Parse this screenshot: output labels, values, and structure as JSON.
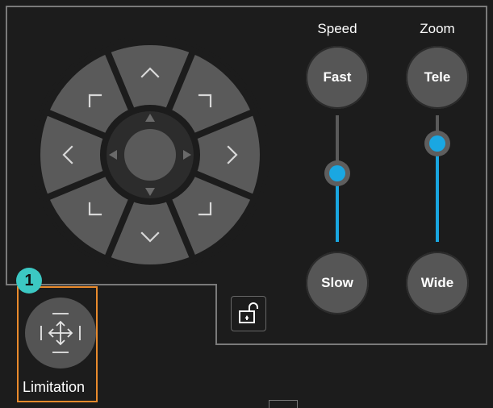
{
  "labels": {
    "speed": "Speed",
    "zoom": "Zoom"
  },
  "speed": {
    "fast": "Fast",
    "slow": "Slow",
    "level": 0.55
  },
  "zoom": {
    "tele": "Tele",
    "wide": "Wide",
    "level": 0.85
  },
  "limitation": {
    "label": "Limitation"
  },
  "badge": {
    "number": "1"
  },
  "colors": {
    "accent": "#19a6e0",
    "highlight_box": "#e98a2c",
    "badge": "#3cc8c3",
    "background": "#1c1c1c",
    "control": "#555555"
  },
  "icons": {
    "lock": "unlock-icon",
    "move": "move-arrows-icon"
  }
}
